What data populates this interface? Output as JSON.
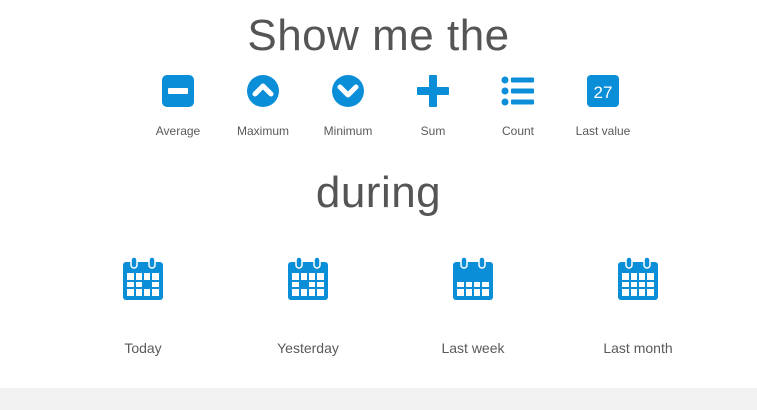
{
  "heading": "Show me the",
  "subheading": "during",
  "accent_color": "#0a8ed8",
  "aggregations": [
    {
      "label": "Average",
      "icon": "minus-square-icon"
    },
    {
      "label": "Maximum",
      "icon": "chevron-up-circle-icon"
    },
    {
      "label": "Minimum",
      "icon": "chevron-down-circle-icon"
    },
    {
      "label": "Sum",
      "icon": "plus-icon"
    },
    {
      "label": "Count",
      "icon": "list-icon"
    },
    {
      "label": "Last value",
      "icon": "calendar-day-icon",
      "badge": "27"
    }
  ],
  "periods": [
    {
      "label": "Today",
      "icon": "calendar-day-icon"
    },
    {
      "label": "Yesterday",
      "icon": "calendar-day-icon"
    },
    {
      "label": "Last week",
      "icon": "calendar-week-icon"
    },
    {
      "label": "Last month",
      "icon": "calendar-month-icon"
    }
  ]
}
